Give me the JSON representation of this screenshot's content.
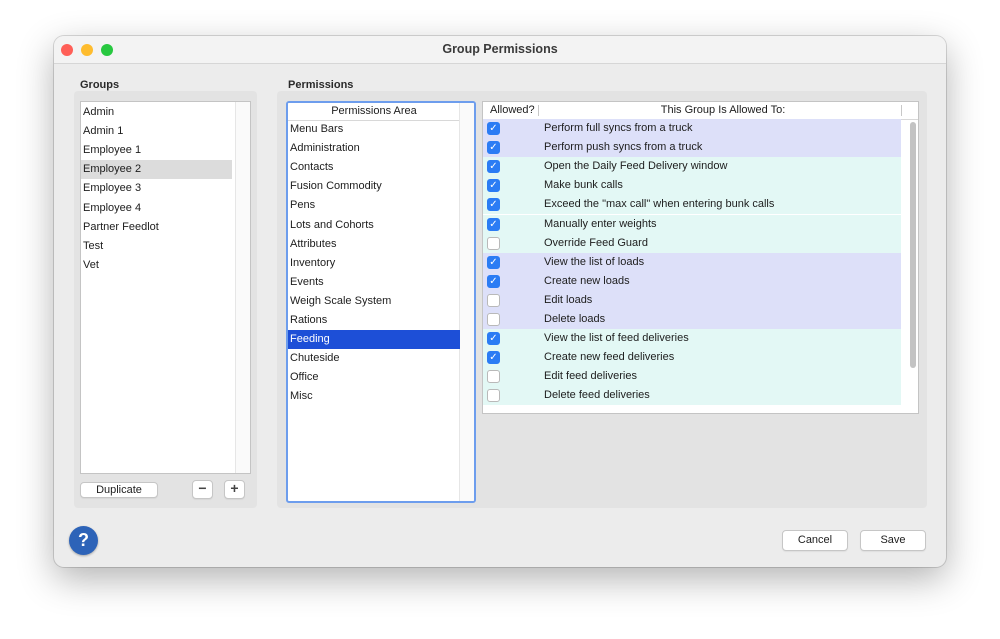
{
  "window": {
    "title": "Group Permissions"
  },
  "groups": {
    "label": "Groups",
    "items": [
      "Admin",
      "Admin 1",
      "Employee 1",
      "Employee 2",
      "Employee 3",
      "Employee 4",
      "Partner Feedlot",
      "Test",
      "Vet"
    ],
    "selected_index": 3,
    "duplicate_label": "Duplicate",
    "remove_label": "−",
    "add_label": "+"
  },
  "permissions": {
    "label": "Permissions",
    "area_header": "Permissions Area",
    "areas": [
      "Menu Bars",
      "Administration",
      "Contacts",
      "Fusion Commodity",
      "Pens",
      "Lots and Cohorts",
      "Attributes",
      "Inventory",
      "Events",
      "Weigh Scale System",
      "Rations",
      "Feeding",
      "Chuteside",
      "Office",
      "Misc"
    ],
    "selected_area_index": 11,
    "table_headers": {
      "allowed": "Allowed?",
      "description": "This Group Is Allowed To:"
    },
    "rows": [
      {
        "allowed": true,
        "text": "Perform full syncs from a truck",
        "color": "#dde0f9"
      },
      {
        "allowed": true,
        "text": "Perform push syncs from a truck",
        "color": "#dde0f9"
      },
      {
        "allowed": true,
        "text": "Open the Daily Feed Delivery window",
        "color": "#e3f8f5"
      },
      {
        "allowed": true,
        "text": "Make bunk calls",
        "color": "#e3f8f5"
      },
      {
        "allowed": true,
        "text": "Exceed the \"max call\" when entering bunk calls",
        "color": "#e3f8f5"
      },
      {
        "allowed": true,
        "text": "Manually enter weights",
        "color": "#e3f8f5"
      },
      {
        "allowed": false,
        "text": "Override Feed Guard",
        "color": "#e3f8f5"
      },
      {
        "allowed": true,
        "text": "View the list of loads",
        "color": "#dde0f9"
      },
      {
        "allowed": true,
        "text": "Create new loads",
        "color": "#dde0f9"
      },
      {
        "allowed": false,
        "text": "Edit loads",
        "color": "#dde0f9"
      },
      {
        "allowed": false,
        "text": "Delete loads",
        "color": "#dde0f9"
      },
      {
        "allowed": true,
        "text": "View the list of feed deliveries",
        "color": "#e3f8f5"
      },
      {
        "allowed": true,
        "text": "Create new feed deliveries",
        "color": "#e3f8f5"
      },
      {
        "allowed": false,
        "text": "Edit feed deliveries",
        "color": "#e3f8f5"
      },
      {
        "allowed": false,
        "text": "Delete feed deliveries",
        "color": "#e3f8f5"
      }
    ]
  },
  "footer": {
    "help_label": "?",
    "cancel_label": "Cancel",
    "save_label": "Save"
  }
}
